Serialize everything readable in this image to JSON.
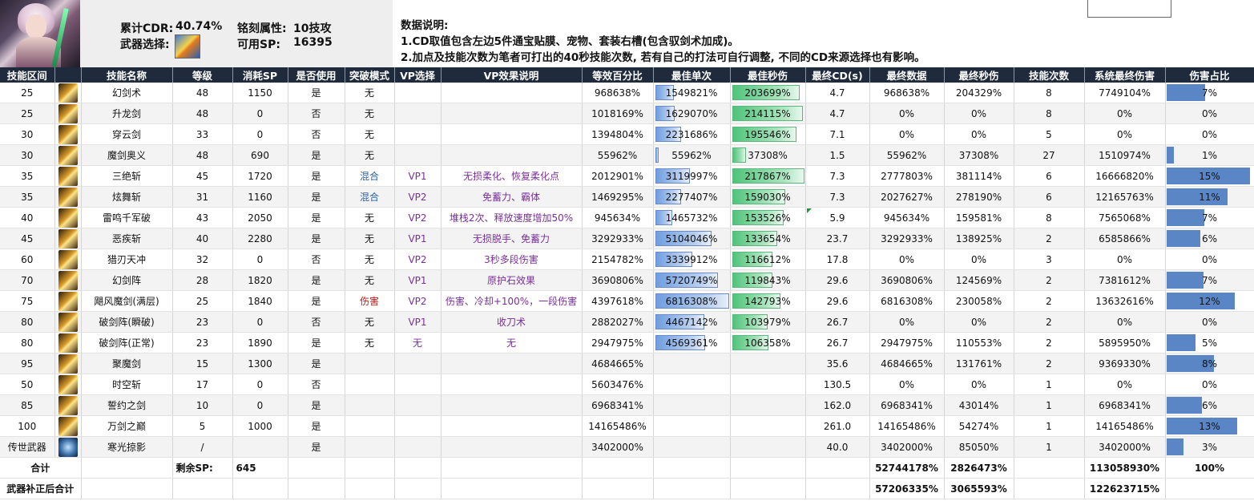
{
  "header": {
    "cdr_label": "累计CDR:",
    "cdr_value": "40.74%",
    "weapon_label": "武器选择:",
    "inscription_label": "铭刻属性:",
    "inscription_value": "10技攻",
    "sp_label": "可用SP:",
    "sp_value": "16395",
    "notes_title": "数据说明:",
    "note1": "1.CD取值包含左边5件通宝贴膜、宠物、套装右槽(包含驭剑术加成)。",
    "note2": "2.加点及技能次数为笔者可打出的40秒技能次数, 若有自己的打法可自行调整, 不同的CD来源选择也有影响。"
  },
  "columns": [
    "技能区间",
    "",
    "技能名称",
    "等级",
    "消耗SP",
    "是否使用",
    "突破模式",
    "VP选择",
    "VP效果说明",
    "等效百分比",
    "最佳单次",
    "最佳秒伤",
    "最终CD(s)",
    "最终数据",
    "最终秒伤",
    "技能次数",
    "系统最终伤害",
    "伤害占比"
  ],
  "rows": [
    {
      "lv": "25",
      "icon": "skill-icon",
      "name": "幻剑术",
      "level": "48",
      "sp": "1150",
      "use": "是",
      "mode": "无",
      "vp": "",
      "vpdesc": "",
      "eq": "968638%",
      "best": "1549821%",
      "best_frac": 0.23,
      "dps": "203699%",
      "dps_frac": 0.93,
      "cd": "4.7",
      "final": "968638%",
      "fdps": "204329%",
      "count": "8",
      "sys": "7749104%",
      "share": "7%",
      "share_frac": 0.46
    },
    {
      "lv": "25",
      "icon": "skill-icon",
      "name": "升龙剑",
      "level": "48",
      "sp": "0",
      "use": "否",
      "mode": "无",
      "vp": "",
      "vpdesc": "",
      "eq": "1018169%",
      "best": "1629070%",
      "best_frac": 0.24,
      "dps": "214115%",
      "dps_frac": 0.98,
      "cd": "4.7",
      "final": "0%",
      "fdps": "0%",
      "count": "8",
      "sys": "0%",
      "share": "0%",
      "share_frac": 0
    },
    {
      "lv": "30",
      "icon": "skill-icon",
      "name": "穿云剑",
      "level": "33",
      "sp": "0",
      "use": "否",
      "mode": "无",
      "vp": "",
      "vpdesc": "",
      "eq": "1394804%",
      "best": "2231686%",
      "best_frac": 0.33,
      "dps": "195546%",
      "dps_frac": 0.89,
      "cd": "7.1",
      "final": "0%",
      "fdps": "0%",
      "count": "5",
      "sys": "0%",
      "share": "0%",
      "share_frac": 0
    },
    {
      "lv": "30",
      "icon": "skill-icon",
      "name": "魔剑奥义",
      "level": "48",
      "sp": "690",
      "use": "是",
      "mode": "无",
      "vp": "",
      "vpdesc": "",
      "eq": "55962%",
      "best": "55962%",
      "best_frac": 0.01,
      "dps": "37308%",
      "dps_frac": 0.17,
      "cd": "1.5",
      "final": "55962%",
      "fdps": "37308%",
      "count": "27",
      "sys": "1510974%",
      "share": "1%",
      "share_frac": 0.09
    },
    {
      "lv": "35",
      "icon": "skill-icon",
      "name": "三绝斩",
      "level": "45",
      "sp": "1720",
      "use": "是",
      "mode": "混合",
      "mode_cls": "blue",
      "vp": "VP1",
      "vpdesc": "无损柔化、恢复柔化点",
      "eq": "2012901%",
      "best": "3119997%",
      "best_frac": 0.46,
      "dps": "217867%",
      "dps_frac": 1.0,
      "cd": "7.3",
      "final": "2777803%",
      "fdps": "381114%",
      "count": "6",
      "sys": "16666820%",
      "share": "15%",
      "share_frac": 1.0
    },
    {
      "lv": "35",
      "icon": "skill-icon",
      "name": "炫舞斩",
      "level": "31",
      "sp": "1160",
      "use": "是",
      "mode": "混合",
      "mode_cls": "blue",
      "vp": "VP2",
      "vpdesc": "免蓄力、霸体",
      "eq": "1469295%",
      "best": "2277407%",
      "best_frac": 0.33,
      "dps": "159030%",
      "dps_frac": 0.73,
      "cd": "7.3",
      "final": "2027627%",
      "fdps": "278190%",
      "count": "6",
      "sys": "12165763%",
      "share": "11%",
      "share_frac": 0.73
    },
    {
      "lv": "40",
      "icon": "skill-icon",
      "name": "雷鸣千军破",
      "level": "43",
      "sp": "2050",
      "use": "是",
      "mode": "无",
      "vp": "VP2",
      "vpdesc": "堆栈2次、释放速度增加50%",
      "eq": "945634%",
      "best": "1465732%",
      "best_frac": 0.21,
      "dps": "153526%",
      "dps_frac": 0.7,
      "cd": "5.9",
      "final": "945634%",
      "fdps": "159581%",
      "count": "8",
      "sys": "7565068%",
      "share": "7%",
      "share_frac": 0.45,
      "flag": true
    },
    {
      "lv": "45",
      "icon": "skill-icon",
      "name": "恶疾斩",
      "level": "40",
      "sp": "2280",
      "use": "是",
      "mode": "无",
      "vp": "VP1",
      "vpdesc": "无损脱手、免蓄力",
      "eq": "3292933%",
      "best": "5104046%",
      "best_frac": 0.75,
      "dps": "133654%",
      "dps_frac": 0.61,
      "cd": "23.7",
      "final": "3292933%",
      "fdps": "138925%",
      "count": "2",
      "sys": "6585866%",
      "share": "6%",
      "share_frac": 0.4
    },
    {
      "lv": "60",
      "icon": "skill-icon",
      "name": "猎刃天冲",
      "level": "32",
      "sp": "0",
      "use": "否",
      "mode": "无",
      "vp": "VP2",
      "vpdesc": "3秒多段伤害",
      "eq": "2154782%",
      "best": "3339912%",
      "best_frac": 0.49,
      "dps": "116612%",
      "dps_frac": 0.54,
      "cd": "17.8",
      "final": "0%",
      "fdps": "0%",
      "count": "3",
      "sys": "0%",
      "share": "0%",
      "share_frac": 0
    },
    {
      "lv": "70",
      "icon": "skill-icon",
      "name": "幻剑阵",
      "level": "28",
      "sp": "1820",
      "use": "是",
      "mode": "无",
      "vp": "VP1",
      "vpdesc": "原护石效果",
      "eq": "3690806%",
      "best": "5720749%",
      "best_frac": 0.84,
      "dps": "119843%",
      "dps_frac": 0.55,
      "cd": "29.6",
      "final": "3690806%",
      "fdps": "124569%",
      "count": "2",
      "sys": "7381612%",
      "share": "7%",
      "share_frac": 0.44
    },
    {
      "lv": "75",
      "icon": "skill-icon",
      "name": "飓风魔剑(满层)",
      "level": "25",
      "sp": "1840",
      "use": "是",
      "mode": "伤害",
      "mode_cls": "red",
      "vp": "VP2",
      "vpdesc": "伤害、冷却+100%，一段伤害",
      "eq": "4397618%",
      "best": "6816308%",
      "best_frac": 1.0,
      "dps": "142793%",
      "dps_frac": 0.66,
      "cd": "29.6",
      "final": "6816308%",
      "fdps": "230058%",
      "count": "2",
      "sys": "13632616%",
      "share": "12%",
      "share_frac": 0.82
    },
    {
      "lv": "80",
      "icon": "skill-icon",
      "name": "破剑阵(瞬破)",
      "level": "23",
      "sp": "0",
      "use": "否",
      "mode": "无",
      "vp": "VP1",
      "vpdesc": "收刀术",
      "eq": "2882027%",
      "best": "4467142%",
      "best_frac": 0.66,
      "dps": "103979%",
      "dps_frac": 0.48,
      "cd": "26.7",
      "final": "0%",
      "fdps": "0%",
      "count": "2",
      "sys": "0%",
      "share": "0%",
      "share_frac": 0
    },
    {
      "lv": "80",
      "icon": "skill-icon",
      "name": "破剑阵(正常)",
      "level": "23",
      "sp": "1890",
      "use": "是",
      "mode": "无",
      "vp": "无",
      "vp_cls": "purple",
      "vpdesc": "无",
      "eq": "2947975%",
      "best": "4569361%",
      "best_frac": 0.67,
      "dps": "106358%",
      "dps_frac": 0.49,
      "cd": "26.7",
      "final": "2947975%",
      "fdps": "110553%",
      "count": "2",
      "sys": "5895950%",
      "share": "5%",
      "share_frac": 0.35
    },
    {
      "lv": "95",
      "icon": "skill-icon",
      "name": "聚魔剑",
      "level": "15",
      "sp": "1300",
      "use": "是",
      "mode": "",
      "vp": "",
      "vpdesc": "",
      "eq": "4684665%",
      "best": "",
      "best_frac": 0,
      "dps": "",
      "dps_frac": 0,
      "cd": "35.6",
      "final": "4684665%",
      "fdps": "131761%",
      "count": "2",
      "sys": "9369330%",
      "share": "8%",
      "share_frac": 0.57
    },
    {
      "lv": "50",
      "icon": "skill-icon",
      "name": "时空斩",
      "level": "17",
      "sp": "0",
      "use": "否",
      "mode": "",
      "vp": "",
      "vpdesc": "",
      "eq": "5603476%",
      "best": "",
      "best_frac": 0,
      "dps": "",
      "dps_frac": 0,
      "cd": "130.5",
      "final": "0%",
      "fdps": "0%",
      "count": "1",
      "sys": "0%",
      "share": "0%",
      "share_frac": 0
    },
    {
      "lv": "85",
      "icon": "skill-icon",
      "name": "誓约之剑",
      "level": "10",
      "sp": "0",
      "use": "是",
      "mode": "",
      "vp": "",
      "vpdesc": "",
      "eq": "6968341%",
      "best": "",
      "best_frac": 0,
      "dps": "",
      "dps_frac": 0,
      "cd": "162.0",
      "final": "6968341%",
      "fdps": "43014%",
      "count": "1",
      "sys": "6968341%",
      "share": "6%",
      "share_frac": 0.42
    },
    {
      "lv": "100",
      "icon": "skill-icon",
      "name": "万剑之巅",
      "level": "5",
      "sp": "1000",
      "use": "是",
      "mode": "",
      "vp": "",
      "vpdesc": "",
      "eq": "14165486%",
      "best": "",
      "best_frac": 0,
      "dps": "",
      "dps_frac": 0,
      "cd": "261.0",
      "final": "14165486%",
      "fdps": "54274%",
      "count": "1",
      "sys": "14165486%",
      "share": "13%",
      "share_frac": 0.85
    },
    {
      "lv": "传世武器",
      "icon": "weapon-skill-icon",
      "name": "寒光掠影",
      "level": "/",
      "sp": "",
      "use": "是",
      "mode": "",
      "vp": "",
      "vpdesc": "",
      "eq": "3402000%",
      "best": "",
      "best_frac": 0,
      "dps": "",
      "dps_frac": 0,
      "cd": "40.0",
      "final": "3402000%",
      "fdps": "85050%",
      "count": "1",
      "sys": "3402000%",
      "share": "3%",
      "share_frac": 0.2
    }
  ],
  "summary": {
    "total_label": "合计",
    "remaining_sp_label": "剩余SP:",
    "remaining_sp_value": "645",
    "total_final": "52744178%",
    "total_fdps": "2826473%",
    "total_sys": "113058930%",
    "total_share": "100%",
    "adjusted_label": "武器补正后合计",
    "adj_final": "57206335%",
    "adj_fdps": "3065593%",
    "adj_sys": "122623715%"
  },
  "colors": {
    "header_bg": "#1f2b3d",
    "bar_blue": "#5b86c6",
    "bar_green": "#4fc47a",
    "vp_purple": "#7a2f9a",
    "mode_blue": "#2a64b0",
    "mode_red": "#c01818"
  }
}
